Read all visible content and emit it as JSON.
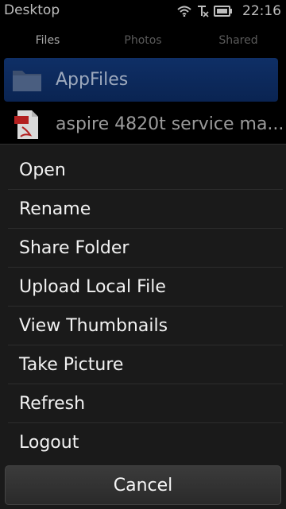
{
  "status": {
    "title": "Desktop",
    "time": "22:16"
  },
  "tabs": [
    {
      "label": "Files",
      "active": true
    },
    {
      "label": "Photos",
      "active": false
    },
    {
      "label": "Shared",
      "active": false
    }
  ],
  "files": [
    {
      "label": "AppFiles",
      "icon": "folder-icon",
      "selected": true
    },
    {
      "label": "aspire 4820t service ma...",
      "icon": "pdf-file-icon",
      "selected": false
    }
  ],
  "menu": {
    "items": [
      "Open",
      "Rename",
      "Share Folder",
      "Upload Local File",
      "View Thumbnails",
      "Take Picture",
      "Refresh",
      "Logout"
    ],
    "cancel_label": "Cancel"
  }
}
